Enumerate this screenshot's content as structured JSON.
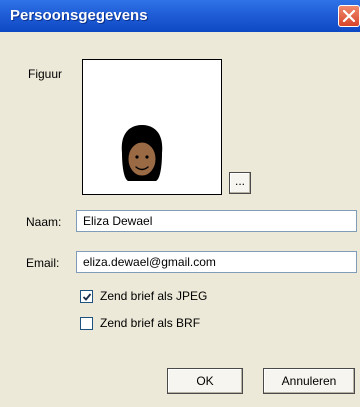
{
  "window": {
    "title": "Persoonsgegevens"
  },
  "figure": {
    "label": "Figuur",
    "browse_button": "..."
  },
  "form": {
    "name_label": "Naam:",
    "name_value": "Eliza Dewael",
    "email_label": "Email:",
    "email_value": "eliza.dewael@gmail.com"
  },
  "options": {
    "jpeg_label": "Zend brief als JPEG",
    "jpeg_checked": true,
    "brf_label": "Zend brief als BRF",
    "brf_checked": false
  },
  "buttons": {
    "ok": "OK",
    "cancel": "Annuleren"
  },
  "colors": {
    "titlebar": "#0e49c4",
    "dialog_bg": "#ece9d8",
    "close_button": "#d6452a"
  },
  "icons": {
    "close": "close-icon",
    "avatar": "avatar-icon",
    "check": "check-icon"
  }
}
